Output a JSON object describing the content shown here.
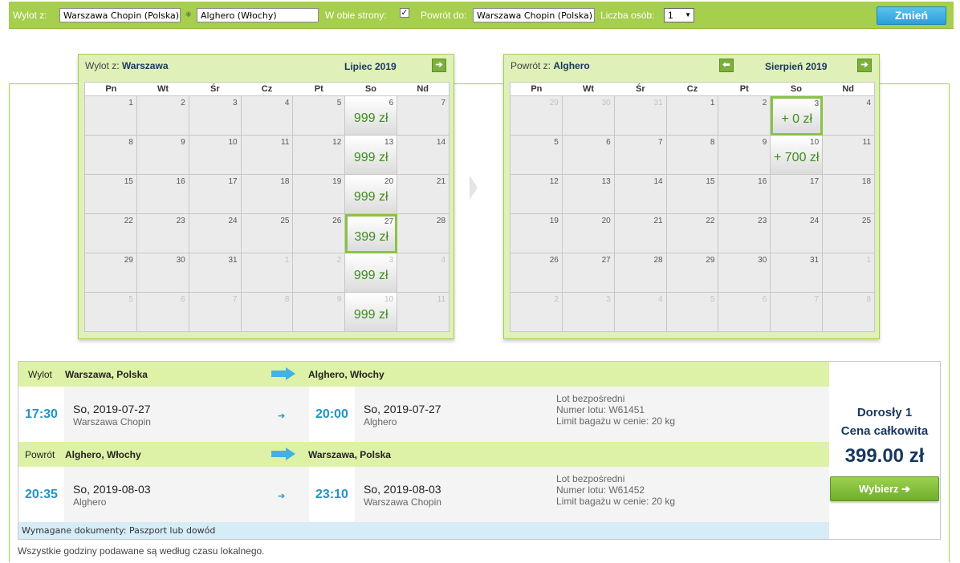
{
  "search": {
    "from_label": "Wylot z:",
    "from_value": "Warszawa Chopin (Polska)",
    "swap_icon": "swap-icon",
    "to_value": "Alghero (Włochy)",
    "both_label": "W obie strony:",
    "both_checked": "✓",
    "return_label": "Powrót do:",
    "return_value": "Warszawa Chopin (Polska)",
    "people_label": "Liczba osób:",
    "people_value": "1",
    "change_button": "Zmień"
  },
  "outbound_calendar": {
    "title_prefix": "Wylot z:",
    "title_city": "Warszawa",
    "month": "Lipiec 2019",
    "weekdays": [
      "Pn",
      "Wt",
      "Śr",
      "Cz",
      "Pt",
      "So",
      "Nd"
    ],
    "weeks": [
      [
        {
          "d": "1"
        },
        {
          "d": "2"
        },
        {
          "d": "3"
        },
        {
          "d": "4"
        },
        {
          "d": "5"
        },
        {
          "d": "6",
          "p": "999 zł"
        },
        {
          "d": "7"
        }
      ],
      [
        {
          "d": "8"
        },
        {
          "d": "9"
        },
        {
          "d": "10"
        },
        {
          "d": "11"
        },
        {
          "d": "12"
        },
        {
          "d": "13",
          "p": "999 zł"
        },
        {
          "d": "14"
        }
      ],
      [
        {
          "d": "15"
        },
        {
          "d": "16"
        },
        {
          "d": "17"
        },
        {
          "d": "18"
        },
        {
          "d": "19"
        },
        {
          "d": "20",
          "p": "999 zł"
        },
        {
          "d": "21"
        }
      ],
      [
        {
          "d": "22"
        },
        {
          "d": "23"
        },
        {
          "d": "24"
        },
        {
          "d": "25"
        },
        {
          "d": "26"
        },
        {
          "d": "27",
          "p": "399 zł",
          "sel": true
        },
        {
          "d": "28"
        }
      ],
      [
        {
          "d": "29"
        },
        {
          "d": "30"
        },
        {
          "d": "31"
        },
        {
          "d": "1",
          "m": true
        },
        {
          "d": "2",
          "m": true
        },
        {
          "d": "3",
          "p": "999 zł",
          "m": true
        },
        {
          "d": "4",
          "m": true
        }
      ],
      [
        {
          "d": "5",
          "m": true
        },
        {
          "d": "6",
          "m": true
        },
        {
          "d": "7",
          "m": true
        },
        {
          "d": "8",
          "m": true
        },
        {
          "d": "9",
          "m": true
        },
        {
          "d": "10",
          "p": "999 zł",
          "m": true
        },
        {
          "d": "11",
          "m": true
        }
      ]
    ]
  },
  "return_calendar": {
    "title_prefix": "Powrót z:",
    "title_city": "Alghero",
    "month": "Sierpień 2019",
    "weekdays": [
      "Pn",
      "Wt",
      "Śr",
      "Cz",
      "Pt",
      "So",
      "Nd"
    ],
    "weeks": [
      [
        {
          "d": "29",
          "m": true
        },
        {
          "d": "30",
          "m": true
        },
        {
          "d": "31",
          "m": true
        },
        {
          "d": "1"
        },
        {
          "d": "2"
        },
        {
          "d": "3",
          "p": "+ 0 zł",
          "sel": true
        },
        {
          "d": "4"
        }
      ],
      [
        {
          "d": "5"
        },
        {
          "d": "6"
        },
        {
          "d": "7"
        },
        {
          "d": "8"
        },
        {
          "d": "9"
        },
        {
          "d": "10",
          "p": "+ 700 zł"
        },
        {
          "d": "11"
        }
      ],
      [
        {
          "d": "12"
        },
        {
          "d": "13"
        },
        {
          "d": "14"
        },
        {
          "d": "15"
        },
        {
          "d": "16"
        },
        {
          "d": "17"
        },
        {
          "d": "18"
        }
      ],
      [
        {
          "d": "19"
        },
        {
          "d": "20"
        },
        {
          "d": "21"
        },
        {
          "d": "22"
        },
        {
          "d": "23"
        },
        {
          "d": "24"
        },
        {
          "d": "25"
        }
      ],
      [
        {
          "d": "26"
        },
        {
          "d": "27"
        },
        {
          "d": "28"
        },
        {
          "d": "29"
        },
        {
          "d": "30"
        },
        {
          "d": "31"
        },
        {
          "d": "1",
          "m": true
        }
      ],
      [
        {
          "d": "2",
          "m": true
        },
        {
          "d": "3",
          "m": true
        },
        {
          "d": "4",
          "m": true
        },
        {
          "d": "5",
          "m": true
        },
        {
          "d": "6",
          "m": true
        },
        {
          "d": "7",
          "m": true
        },
        {
          "d": "8",
          "m": true
        }
      ]
    ]
  },
  "outbound": {
    "label": "Wylot",
    "from": "Warszawa, Polska",
    "to": "Alghero, Włochy",
    "dep_time": "17:30",
    "dep_date": "So, 2019-07-27",
    "dep_airport": "Warszawa Chopin",
    "arr_time": "20:00",
    "arr_date": "So, 2019-07-27",
    "arr_airport": "Alghero",
    "info1": "Lot bezpośredni",
    "info2": "Numer lotu: W61451",
    "info3": "Limit bagażu w cenie: 20 kg"
  },
  "return": {
    "label": "Powrót",
    "from": "Alghero, Włochy",
    "to": "Warszawa, Polska",
    "dep_time": "20:35",
    "dep_date": "So, 2019-08-03",
    "dep_airport": "Alghero",
    "arr_time": "23:10",
    "arr_date": "So, 2019-08-03",
    "arr_airport": "Warszawa Chopin",
    "info1": "Lot bezpośredni",
    "info2": "Numer lotu: W61452",
    "info3": "Limit bagażu w cenie: 20 kg"
  },
  "documents": "Wymagane dokumenty: Paszport lub dowód",
  "price": {
    "adult": "Dorosły 1",
    "total_label": "Cena całkowita",
    "amount": "399.00 zł",
    "choose_button": "Wybierz ➔"
  },
  "footer_note": "Wszystkie godziny podawane są według czasu lokalnego.",
  "nav": {
    "next_arrow": "➔",
    "prev_arrow": "⬅",
    "small_arrow": "➔"
  },
  "colors": {
    "brand_green": "#a5cf4c",
    "price_green": "#3f8d1e",
    "time_blue": "#1f95c9",
    "heading_navy": "#17375e"
  }
}
